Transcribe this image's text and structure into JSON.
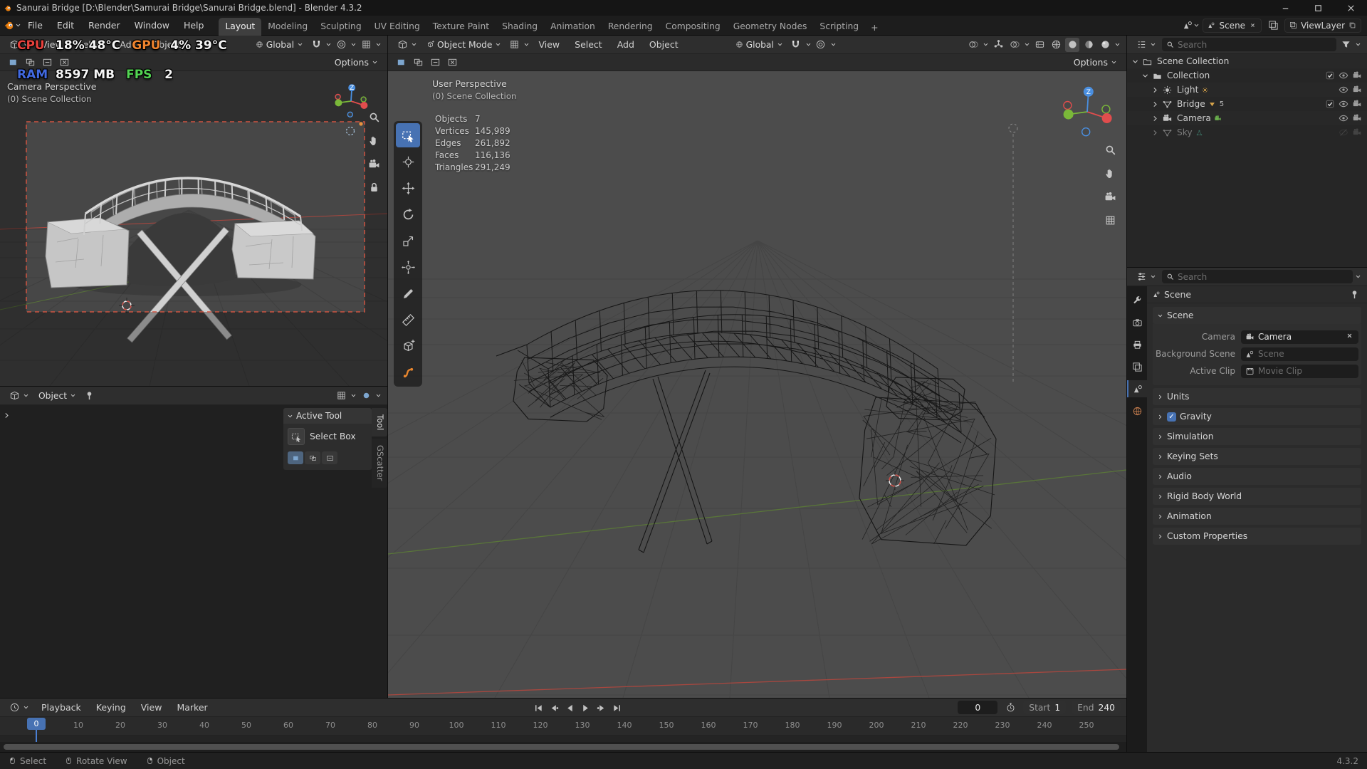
{
  "window": {
    "title": "Sanurai Bridge [D:\\Blender\\Samurai Bridge\\Sanurai Bridge.blend] - Blender 4.3.2"
  },
  "topbar": {
    "menus": [
      "File",
      "Edit",
      "Render",
      "Window",
      "Help"
    ],
    "workspaces": [
      "Layout",
      "Modeling",
      "Sculpting",
      "UV Editing",
      "Texture Paint",
      "Shading",
      "Animation",
      "Rendering",
      "Compositing",
      "Geometry Nodes",
      "Scripting"
    ],
    "active_workspace": "Layout",
    "add_workspace": "+",
    "scene_name": "Scene",
    "viewlayer_name": "ViewLayer"
  },
  "osd": {
    "lines": [
      [
        {
          "label": "CPU",
          "value": "18% 48°C",
          "color": "#e8413c"
        },
        {
          "label": "GPU",
          "value": "4% 39°C",
          "color": "#f0842e"
        }
      ],
      [
        {
          "label": "RAM",
          "value": "8597 MB",
          "color": "#4169e0"
        },
        {
          "label": "FPS",
          "value": "2",
          "color": "#53d453"
        }
      ]
    ]
  },
  "camera_view": {
    "menus": [
      "View",
      "Select",
      "Add",
      "Object"
    ],
    "orientation": "Global",
    "options_label": "Options",
    "overlay_line1": "Camera Perspective",
    "overlay_line2": "(0) Scene Collection"
  },
  "main_view": {
    "mode": "Object Mode",
    "menus": [
      "View",
      "Select",
      "Add",
      "Object"
    ],
    "orientation": "Global",
    "options_label": "Options",
    "overlay_line1": "User Perspective",
    "overlay_line2": "(0) Scene Collection",
    "stats": [
      {
        "label": "Objects",
        "value": "7"
      },
      {
        "label": "Vertices",
        "value": "145,989"
      },
      {
        "label": "Edges",
        "value": "261,892"
      },
      {
        "label": "Faces",
        "value": "116,136"
      },
      {
        "label": "Triangles",
        "value": "291,249"
      }
    ],
    "tools": [
      "select-box",
      "cursor",
      "move",
      "rotate",
      "scale",
      "transform",
      "annotate",
      "measure",
      "add-cube",
      "gscatter"
    ],
    "active_tool": "select-box"
  },
  "tool_panel": {
    "mode_label": "Object",
    "tabs": [
      "Tool",
      "GScatter"
    ],
    "active_tab": "Tool",
    "section": "Active Tool",
    "tool_name": "Select Box"
  },
  "outliner": {
    "search_placeholder": "Search",
    "rows": [
      {
        "label": "Scene Collection",
        "icon": "scenecol",
        "depth": 0,
        "chev": "down",
        "right": []
      },
      {
        "label": "Collection",
        "icon": "collection",
        "depth": 1,
        "chev": "down",
        "right": [
          "check",
          "eye",
          "camera"
        ]
      },
      {
        "label": "Light",
        "icon": "light",
        "depth": 2,
        "chev": "right",
        "data_icon": "sun",
        "right": [
          "eye",
          "camera"
        ]
      },
      {
        "label": "Bridge",
        "icon": "meshT",
        "depth": 2,
        "chev": "right",
        "data_icon": "meshd",
        "badge": "5",
        "right": [
          "check",
          "eye",
          "camera"
        ]
      },
      {
        "label": "Camera",
        "icon": "camO",
        "depth": 2,
        "chev": "right",
        "data_icon": "camact",
        "right": [
          "eye",
          "camera"
        ]
      },
      {
        "label": "Sky",
        "icon": "meshT",
        "depth": 2,
        "chev": "right",
        "data_icon": "nodes",
        "dim": true,
        "right": [
          "eyeoff",
          "cameradim"
        ]
      }
    ]
  },
  "properties": {
    "search_placeholder": "Search",
    "breadcrumb": "Scene",
    "tabs": [
      "tool",
      "render",
      "output",
      "viewlayer",
      "scene",
      "world"
    ],
    "active_tab": "scene",
    "section": "Scene",
    "fields": [
      {
        "label": "Camera",
        "value": "Camera",
        "icon": "camO",
        "clearable": true,
        "placeholder": false
      },
      {
        "label": "Background Scene",
        "value": "Scene",
        "icon": "sceneIc",
        "clearable": false,
        "placeholder": true
      },
      {
        "label": "Active Clip",
        "value": "Movie Clip",
        "icon": "clip",
        "clearable": false,
        "placeholder": true
      }
    ],
    "panels": [
      "Units",
      "Gravity",
      "Simulation",
      "Keying Sets",
      "Audio",
      "Rigid Body World",
      "Animation",
      "Custom Properties"
    ],
    "gravity_checked": true
  },
  "timeline": {
    "menus": [
      "Playback",
      "Keying",
      "View",
      "Marker"
    ],
    "transport": [
      "jump-start",
      "prev-key",
      "play-back",
      "play",
      "next-key",
      "jump-end"
    ],
    "current_frame": "0",
    "start_label": "Start",
    "start_value": "1",
    "end_label": "End",
    "end_value": "240",
    "ticks": [
      0,
      10,
      20,
      30,
      40,
      50,
      60,
      70,
      80,
      90,
      100,
      110,
      120,
      130,
      140,
      150,
      160,
      170,
      180,
      190,
      200,
      210,
      220,
      230,
      240,
      250
    ],
    "playhead_frame": 0
  },
  "statusbar": {
    "items": [
      {
        "icon": "mouseL",
        "label": "Select"
      },
      {
        "icon": "mouseM",
        "label": "Rotate View"
      },
      {
        "icon": "mouseR",
        "label": "Object"
      }
    ],
    "version": "4.3.2"
  },
  "colors": {
    "accent": "#4772b3",
    "axis_x": "#a8473f",
    "axis_y": "#5c7d36",
    "gizmo_x": "#e14d4d",
    "gizmo_y": "#7ab839",
    "gizmo_z": "#4a8fe0",
    "gscatter_orange": "#e8862e"
  }
}
